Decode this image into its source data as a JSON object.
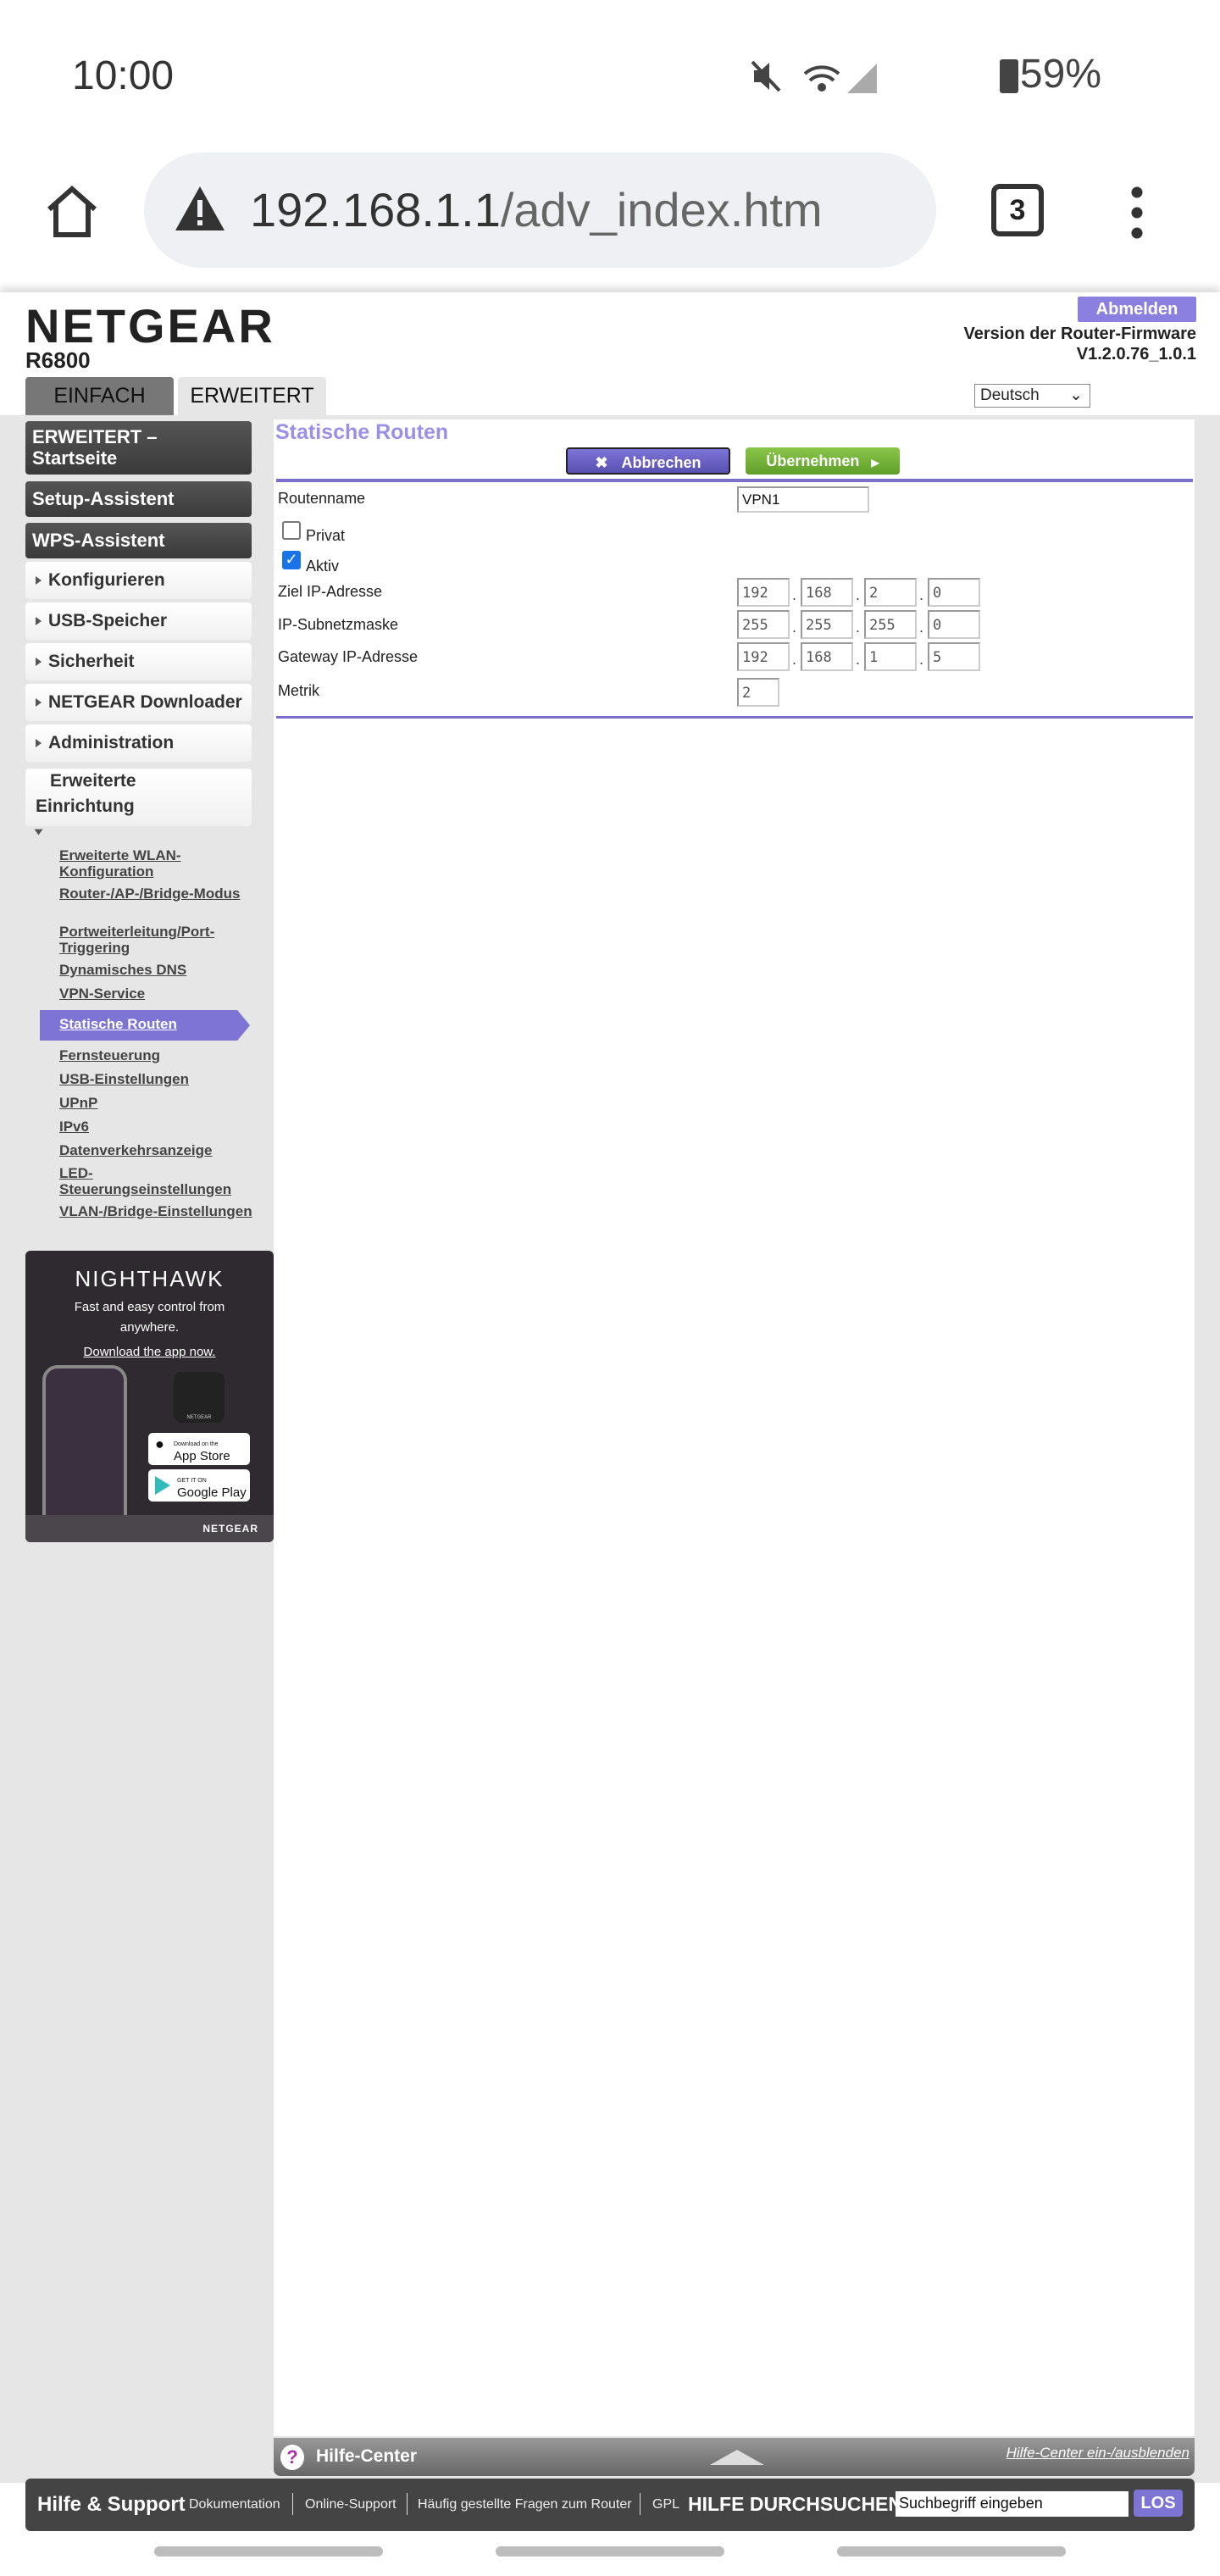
{
  "status_bar": {
    "time": "10:00",
    "battery": "59%",
    "icons": [
      "mute-icon",
      "wifi-icon",
      "signal-icon",
      "battery-icon"
    ]
  },
  "browser": {
    "url_host": "192.168.1.1",
    "url_path": "/adv_index.htm",
    "tab_count": "3",
    "icons": [
      "home-icon",
      "warning-icon",
      "tabs-icon",
      "menu-icon"
    ]
  },
  "header": {
    "brand": "NETGEAR",
    "model": "R6800",
    "logout": "Abmelden",
    "firmware_label": "Version der Router-Firmware",
    "firmware_version": "V1.2.0.76_1.0.1",
    "tabs": [
      "EINFACH",
      "ERWEITERT"
    ],
    "language": "Deutsch"
  },
  "sidebar": {
    "dark_items": [
      "ERWEITERT – Startseite",
      "Setup-Assistent",
      "WPS-Assistent"
    ],
    "items": [
      "Konfigurieren",
      "USB-Speicher",
      "Sicherheit",
      "NETGEAR Downloader",
      "Administration",
      "Erweiterte Einrichtung"
    ],
    "subitems": [
      "Erweiterte WLAN-Konfiguration",
      "Router-/AP-/Bridge-Modus",
      "Portweiterleitung/Port-Triggering",
      "Dynamisches DNS",
      "VPN-Service",
      "Statische Routen",
      "Fernsteuerung",
      "USB-Einstellungen",
      "UPnP",
      "IPv6",
      "Datenverkehrsanzeige",
      "LED-Steuerungseinstellungen",
      "VLAN-/Bridge-Einstellungen"
    ],
    "selected": "Statische Routen"
  },
  "ad": {
    "brand": "NIGHTHAWK",
    "tagline": "Fast and easy control from anywhere.",
    "link": "Download the app now.",
    "app_store": "App Store",
    "app_store_small": "Download on the",
    "google_play": "Google Play",
    "google_play_small": "GET IT ON",
    "footer_brand": "NETGEAR"
  },
  "main": {
    "title": "Statische Routen",
    "cancel": "Abbrechen",
    "apply": "Übernehmen",
    "route_name_label": "Routenname",
    "route_name": "VPN1",
    "private_label": "Privat",
    "private_checked": false,
    "active_label": "Aktiv",
    "active_checked": true,
    "dest_label": "Ziel IP-Adresse",
    "dest": [
      "192",
      "168",
      "2",
      "0"
    ],
    "mask_label": "IP-Subnetzmaske",
    "mask": [
      "255",
      "255",
      "255",
      "0"
    ],
    "gw_label": "Gateway IP-Adresse",
    "gw": [
      "192",
      "168",
      "1",
      "5"
    ],
    "metric_label": "Metrik",
    "metric": "2"
  },
  "help": {
    "title": "Hilfe-Center",
    "toggle": "Hilfe-Center ein-/ausblenden"
  },
  "footer": {
    "title": "Hilfe & Support",
    "links": [
      "Dokumentation",
      "Online-Support",
      "Häufig gestellte Fragen zum Router",
      "GPL"
    ],
    "search_label": "HILFE DURCHSUCHEN",
    "search_placeholder": "Suchbegriff eingeben",
    "search_button": "LOS"
  },
  "colors": {
    "accent": "#7d74d6",
    "apply_green": "#6aa832",
    "dark": "#444444"
  }
}
